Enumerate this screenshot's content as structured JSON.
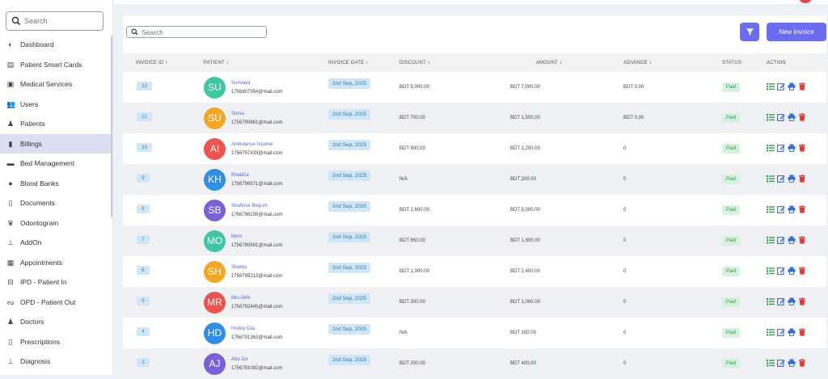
{
  "sidebar": {
    "search_placeholder": "Search",
    "items": [
      {
        "label": "Dashboard",
        "icon": "dashboard-icon",
        "glyph": "◐",
        "active": false
      },
      {
        "label": "Patient Smart Cards",
        "icon": "id-card-icon",
        "glyph": "▤",
        "active": false
      },
      {
        "label": "Medical Services",
        "icon": "medical-services-icon",
        "glyph": "▣",
        "active": false
      },
      {
        "label": "Users",
        "icon": "users-icon",
        "glyph": "👥",
        "active": false
      },
      {
        "label": "Patients",
        "icon": "patient-icon",
        "glyph": "♟",
        "active": false
      },
      {
        "label": "Billings",
        "icon": "billing-icon",
        "glyph": "▮",
        "active": true
      },
      {
        "label": "Bed Management",
        "icon": "bed-icon",
        "glyph": "▬",
        "active": false
      },
      {
        "label": "Blood Banks",
        "icon": "blood-drop-icon",
        "glyph": "●",
        "active": false
      },
      {
        "label": "Documents",
        "icon": "document-icon",
        "glyph": "▯",
        "active": false
      },
      {
        "label": "Odontogram",
        "icon": "tooth-icon",
        "glyph": "♛",
        "active": false
      },
      {
        "label": "AddOn",
        "icon": "addon-icon",
        "glyph": "⊥",
        "active": false
      },
      {
        "label": "Appointments",
        "icon": "calendar-icon",
        "glyph": "▦",
        "active": false
      },
      {
        "label": "IPD - Patient In",
        "icon": "ipd-icon",
        "glyph": "⊟",
        "active": false
      },
      {
        "label": "OPD - Patient Out",
        "icon": "stethoscope-icon",
        "glyph": "ᔓ",
        "active": false
      },
      {
        "label": "Doctors",
        "icon": "doctor-icon",
        "glyph": "♟",
        "active": false
      },
      {
        "label": "Prescriptions",
        "icon": "prescription-icon",
        "glyph": "▯",
        "active": false
      },
      {
        "label": "Diagnosis",
        "icon": "diagnosis-icon",
        "glyph": "⊥",
        "active": false
      }
    ]
  },
  "toolbar": {
    "search_placeholder": "Search",
    "new_invoice_label": "New Invoice"
  },
  "table": {
    "headers": [
      "INVOICE ID ↕",
      "PATIENT ↕",
      "INVOICE DATE ↕",
      "DISCOUNT ↕",
      "AMOUNT ↕",
      "ADVANCE ↕",
      "STATUS",
      "ACTION"
    ],
    "rows": [
      {
        "id": "12",
        "initials": "SU",
        "color": "#3ec7a3",
        "name": "Sumaiya",
        "email": "1756807954@mail.com",
        "date": "2nd Sep, 2025",
        "discount": "BDT 5,000.00",
        "amount": "BDT 7,000.00",
        "advance": "BDT 0.00",
        "status": "Paid"
      },
      {
        "id": "11",
        "initials": "SU",
        "color": "#f5a623",
        "name": "Suma",
        "email": "1756799861@mail.com",
        "date": "2nd Sep, 2025",
        "discount": "BDT 700.00",
        "amount": "BDT 1,500.00",
        "advance": "BDT 0.00",
        "status": "Paid"
      },
      {
        "id": "10",
        "initials": "AI",
        "color": "#ef5350",
        "name": "Ambulance Income",
        "email": "1756797433@mail.com",
        "date": "2nd Sep, 2025",
        "discount": "BDT 800.00",
        "amount": "BDT 1,200.00",
        "advance": "0",
        "status": "Paid"
      },
      {
        "id": "9",
        "initials": "KH",
        "color": "#2f8fe6",
        "name": "Khadiza",
        "email": "1756796571@mail.com",
        "date": "2nd Sep, 2025",
        "discount": "N/A",
        "amount": "BDT 200.00",
        "advance": "0",
        "status": "Paid"
      },
      {
        "id": "8",
        "initials": "SB",
        "color": "#7b61d9",
        "name": "Shahinur Begum",
        "email": "1756796239@mail.com",
        "date": "2nd Sep, 2025",
        "discount": "BDT 2,600.00",
        "amount": "BDT 5,000.00",
        "advance": "0",
        "status": "Paid"
      },
      {
        "id": "7",
        "initials": "MO",
        "color": "#3ec7a3",
        "name": "Moni",
        "email": "1756795691@mail.com",
        "date": "2nd Sep, 2025",
        "discount": "BDT 650.00",
        "amount": "BDT 1,800.00",
        "advance": "0",
        "status": "Paid"
      },
      {
        "id": "6",
        "initials": "SH",
        "color": "#f5a623",
        "name": "Shanta",
        "email": "1756795213@mail.com",
        "date": "2nd Sep, 2025",
        "discount": "BDT 1,000.00",
        "amount": "BDT 2,400.00",
        "advance": "0",
        "status": "Paid"
      },
      {
        "id": "5",
        "initials": "MR",
        "color": "#ef5350",
        "name": "Mrs.Akhi",
        "email": "1756792445@mail.com",
        "date": "2nd Sep, 2025",
        "discount": "BDT 300.00",
        "amount": "BDT 1,000.00",
        "advance": "0",
        "status": "Paid"
      },
      {
        "id": "4",
        "initials": "HD",
        "color": "#2f8fe6",
        "name": "Hridoy Das",
        "email": "1756791363@mail.com",
        "date": "2nd Sep, 2025",
        "discount": "N/A",
        "amount": "BDT 100.00",
        "advance": "0",
        "status": "Paid"
      },
      {
        "id": "3",
        "initials": "AJ",
        "color": "#7b61d9",
        "name": "Abu Jor",
        "email": "1756791082@mail.com",
        "date": "2nd Sep, 2025",
        "discount": "BDT 200.00",
        "amount": "BDT 400.00",
        "advance": "0",
        "status": "Paid"
      }
    ]
  },
  "colors": {
    "accent": "#6c6cf0",
    "list_icon": "#2e9e48",
    "edit_icon": "#2f6fe6",
    "print_icon": "#2f6fe6",
    "delete_icon": "#e53935"
  }
}
